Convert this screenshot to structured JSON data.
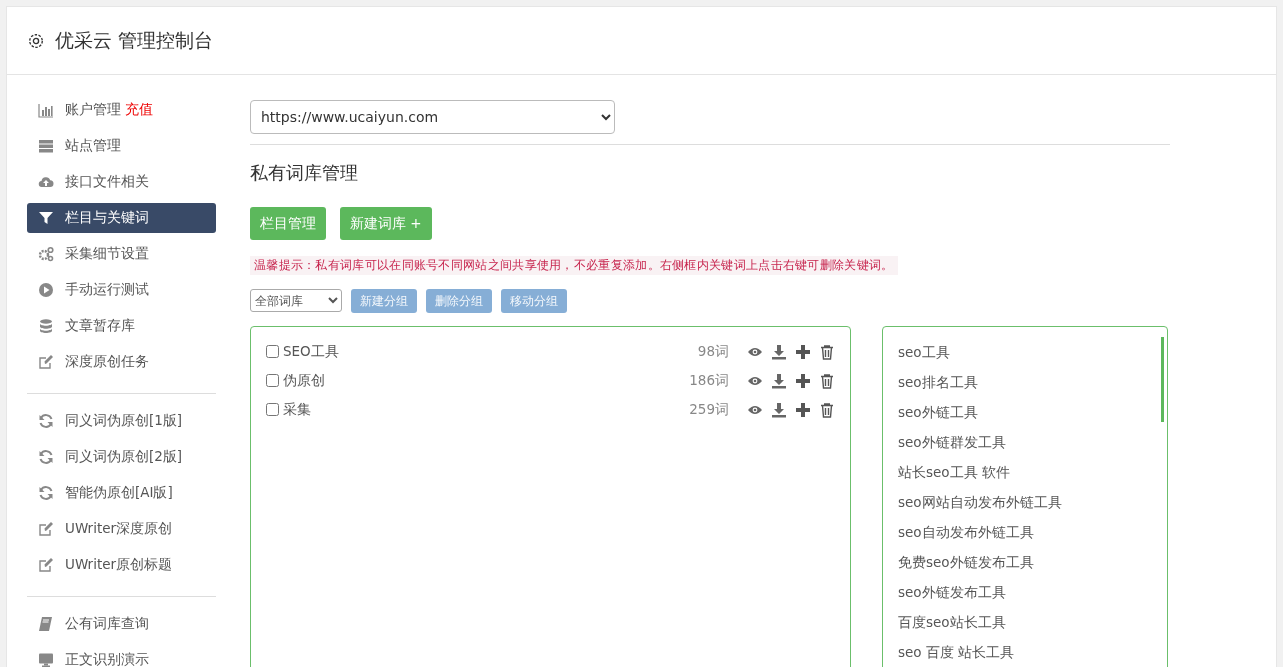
{
  "header": {
    "title": "优采云 管理控制台"
  },
  "sidebar": {
    "groups": [
      {
        "items": [
          {
            "label": "账户管理",
            "badge": "充值",
            "selected": false
          },
          {
            "label": "站点管理",
            "selected": false
          },
          {
            "label": "接口文件相关",
            "selected": false
          },
          {
            "label": "栏目与关键词",
            "selected": true
          },
          {
            "label": "采集细节设置",
            "selected": false
          },
          {
            "label": "手动运行测试",
            "selected": false
          },
          {
            "label": "文章暂存库",
            "selected": false
          },
          {
            "label": "深度原创任务",
            "selected": false
          }
        ]
      },
      {
        "items": [
          {
            "label": "同义词伪原创[1版]",
            "selected": false
          },
          {
            "label": "同义词伪原创[2版]",
            "selected": false
          },
          {
            "label": "智能伪原创[AI版]",
            "selected": false
          },
          {
            "label": "UWriter深度原创",
            "selected": false
          },
          {
            "label": "UWriter原创标题",
            "selected": false
          }
        ]
      },
      {
        "items": [
          {
            "label": "公有词库查询",
            "selected": false
          },
          {
            "label": "正文识别演示",
            "selected": false
          }
        ]
      }
    ]
  },
  "site_select": {
    "value": "https://www.ucaiyun.com"
  },
  "section_title": "私有词库管理",
  "actions": [
    "栏目管理",
    "新建词库 +"
  ],
  "tip": "温馨提示：私有词库可以在同账号不同网站之间共享使用，不必重复添加。右侧框内关键词上点击右键可删除关键词。",
  "filter_select": {
    "value": "全部词库"
  },
  "group_buttons": [
    "新建分组",
    "删除分组",
    "移动分组"
  ],
  "libraries": [
    {
      "name": "SEO工具",
      "count": "98词",
      "checked": false
    },
    {
      "name": "伪原创",
      "count": "186词",
      "checked": false
    },
    {
      "name": "采集",
      "count": "259词",
      "checked": false
    }
  ],
  "keywords": [
    "seo工具",
    "seo排名工具",
    "seo外链工具",
    "seo外链群发工具",
    "站长seo工具 软件",
    "seo网站自动发布外链工具",
    "seo自动发布外链工具",
    "免费seo外链发布工具",
    "seo外链发布工具",
    "百度seo站长工具",
    "seo 百度 站长工具"
  ]
}
